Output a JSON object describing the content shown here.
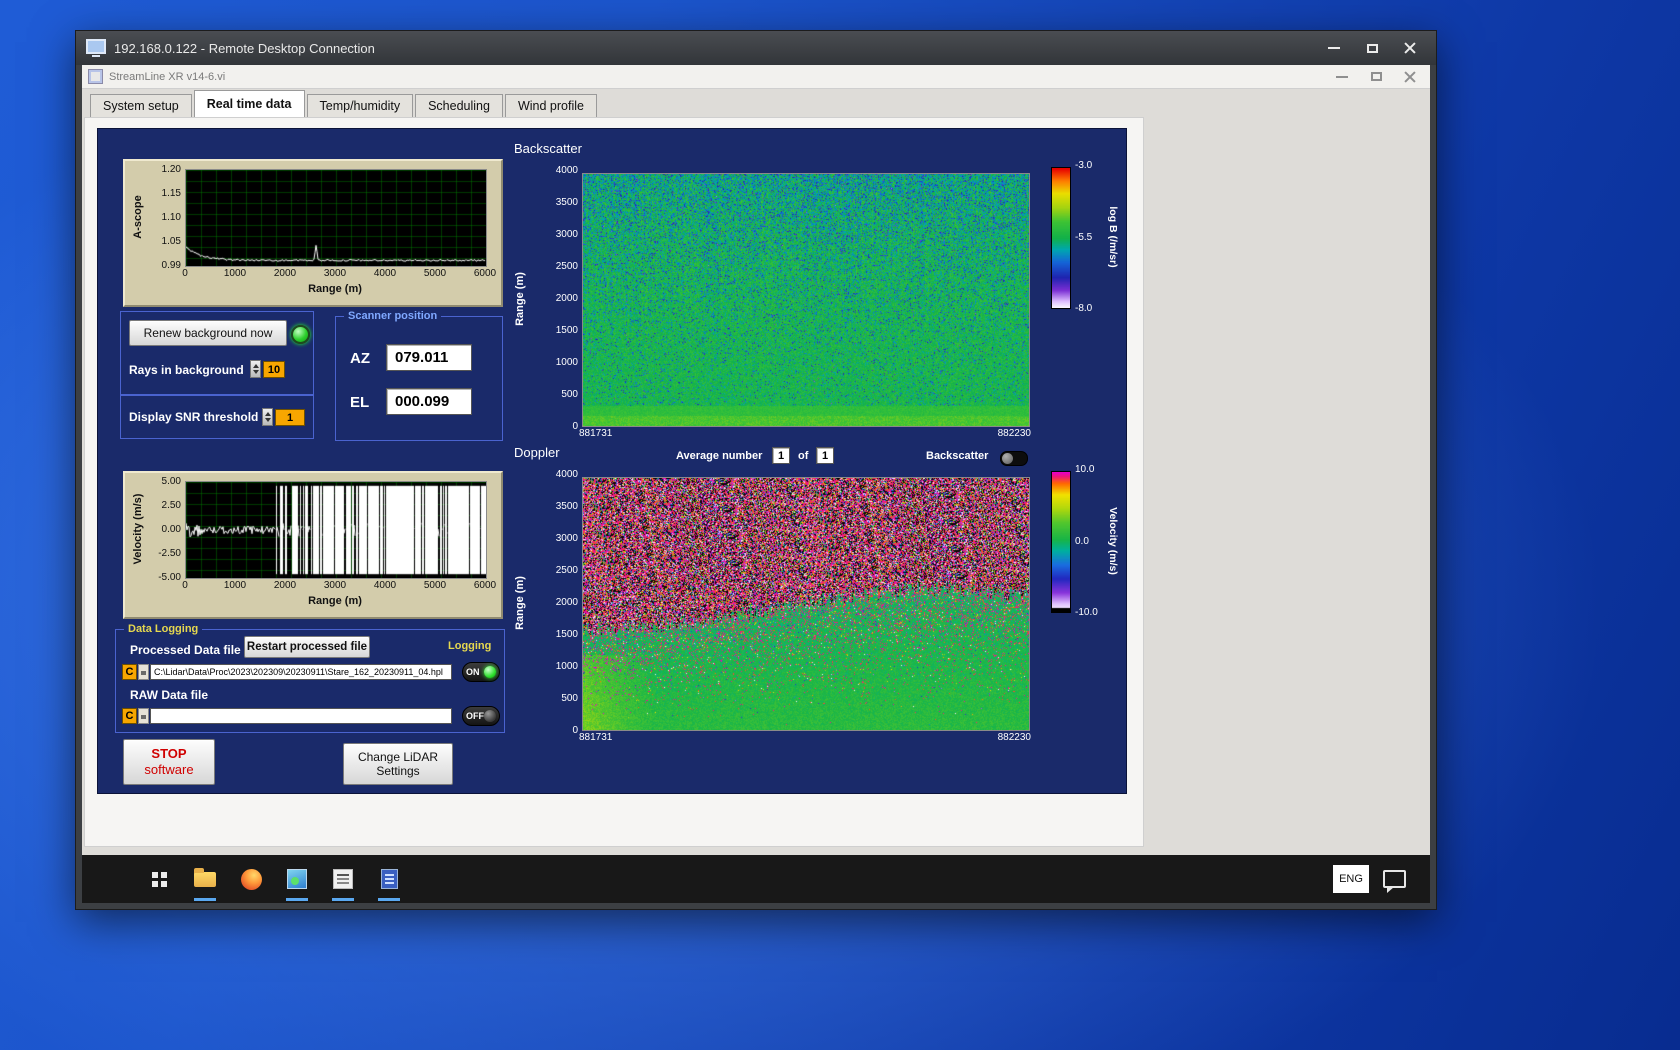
{
  "rdp": {
    "title": "192.168.0.122 - Remote Desktop Connection"
  },
  "app": {
    "title": "StreamLine XR v14-6.vi",
    "tabs": [
      {
        "label": "System setup",
        "active": false
      },
      {
        "label": "Real time data",
        "active": true
      },
      {
        "label": "Temp/humidity",
        "active": false
      },
      {
        "label": "Scheduling",
        "active": false
      },
      {
        "label": "Wind profile",
        "active": false
      }
    ]
  },
  "controls": {
    "renew_button": "Renew background now",
    "rays_label": "Rays in background",
    "rays_value": "10",
    "snr_label": "Display SNR threshold",
    "snr_value": "1",
    "scanner": {
      "title": "Scanner position",
      "az_label": "AZ",
      "az_value": "079.011",
      "el_label": "EL",
      "el_value": "000.099"
    }
  },
  "logging": {
    "title": "Data Logging",
    "processed_label": "Processed Data file",
    "restart_button": "Restart processed file",
    "logging_label": "Logging",
    "drive_letter": "C",
    "processed_path": "C:\\Lidar\\Data\\Proc\\2023\\202309\\20230911\\Stare_162_20230911_04.hpl",
    "raw_label": "RAW Data file",
    "raw_path": "",
    "on_label": "ON",
    "off_label": "OFF"
  },
  "footer_buttons": {
    "stop_line1": "STOP",
    "stop_line2": "software",
    "change_line1": "Change LiDAR",
    "change_line2": "Settings"
  },
  "doppler_controls": {
    "average_label": "Average number",
    "average_value": "1",
    "of_label": "of",
    "of_value": "1",
    "toggle_label": "Backscatter"
  },
  "taskbar": {
    "language": "ENG",
    "items": [
      {
        "name": "start"
      },
      {
        "name": "file-explorer",
        "running": true
      },
      {
        "name": "firefox",
        "running": false
      },
      {
        "name": "photos",
        "running": true
      },
      {
        "name": "scan-scheduler",
        "running": true
      },
      {
        "name": "document-viewer",
        "running": true
      }
    ]
  },
  "chart_data": [
    {
      "id": "ascope",
      "type": "line",
      "ylabel": "A-scope",
      "xlabel": "Range (m)",
      "yticks": [
        "1.20",
        "1.15",
        "1.10",
        "1.05",
        "0.99"
      ],
      "xticks": [
        "0",
        "1000",
        "2000",
        "3000",
        "4000",
        "5000",
        "6000"
      ],
      "ylim": [
        0.985,
        1.205
      ],
      "xlim": [
        0,
        6000
      ],
      "bg": "#000000",
      "grid": "#008200",
      "trace": "#ffffff",
      "description": "White trace near 1.00; slightly elevated (~1.03) below 500 m, small spike near 2600 m"
    },
    {
      "id": "velocity",
      "type": "line",
      "ylabel": "Velocity (m/s)",
      "xlabel": "Range (m)",
      "yticks": [
        "5.00",
        "2.50",
        "0.00",
        "-2.50",
        "-5.00"
      ],
      "xticks": [
        "0",
        "1000",
        "2000",
        "3000",
        "4000",
        "5000",
        "6000"
      ],
      "ylim": [
        -5.5,
        5.5
      ],
      "xlim": [
        0,
        6000
      ],
      "spike_start_m": 1800,
      "bg": "#000000",
      "grid": "#008200",
      "trace": "#ffffff",
      "description": "Low-amplitude noise around 0 below ~1800 m, dense saturated +/-5 m/s vertical spikes beyond"
    },
    {
      "id": "backscatter",
      "type": "heatmap",
      "title": "Backscatter",
      "ylabel": "Range (m)",
      "yticks": [
        "4000",
        "3500",
        "3000",
        "2500",
        "2000",
        "1500",
        "1000",
        "500",
        "0"
      ],
      "xticks": [
        "881731",
        "882230"
      ],
      "ylim": [
        0,
        4000
      ],
      "xlim": [
        881731,
        882230
      ],
      "colorbar": {
        "label": "log B (/m/sr)",
        "ticks": [
          "-3.0",
          "-5.5",
          "-8.0"
        ],
        "range": [
          -3.0,
          -8.0
        ]
      },
      "cmap": [
        [
          0,
          "#ffffff"
        ],
        [
          0.05,
          "#dfc0ff"
        ],
        [
          0.13,
          "#7b2fd4"
        ],
        [
          0.22,
          "#1f24b0"
        ],
        [
          0.33,
          "#1565d8"
        ],
        [
          0.42,
          "#00a8b0"
        ],
        [
          0.5,
          "#12b14a"
        ],
        [
          0.62,
          "#3ec435"
        ],
        [
          0.72,
          "#a6d411"
        ],
        [
          0.82,
          "#eadf00"
        ],
        [
          0.91,
          "#ff7d00"
        ],
        [
          1,
          "#e80000"
        ]
      ],
      "description": "Mostly green (~-5.5) field, blue/dark speckle density increasing with altitude, bright smooth green band below ~500 m"
    },
    {
      "id": "doppler",
      "type": "heatmap",
      "title": "Doppler",
      "ylabel": "Range (m)",
      "yticks": [
        "4000",
        "3500",
        "3000",
        "2500",
        "2000",
        "1500",
        "1000",
        "500",
        "0"
      ],
      "xticks": [
        "881731",
        "882230"
      ],
      "ylim": [
        0,
        4000
      ],
      "xlim": [
        881731,
        882230
      ],
      "colorbar": {
        "label": "Velocity (m/s)",
        "ticks": [
          "10.0",
          "0.0",
          "-10.0"
        ],
        "range": [
          10.0,
          -10.0
        ]
      },
      "cmap": [
        [
          0,
          "#ffffff"
        ],
        [
          0.06,
          "#e2c4ff"
        ],
        [
          0.14,
          "#8a34dc"
        ],
        [
          0.24,
          "#2228c0"
        ],
        [
          0.34,
          "#1a6ee0"
        ],
        [
          0.44,
          "#00b0a0"
        ],
        [
          0.52,
          "#18b547"
        ],
        [
          0.64,
          "#52c72e"
        ],
        [
          0.74,
          "#b0d80e"
        ],
        [
          0.84,
          "#f2e200"
        ],
        [
          0.92,
          "#ff6a00"
        ],
        [
          0.97,
          "#f01878"
        ],
        [
          1,
          "#e800c8"
        ]
      ],
      "description": "Magenta/black random noise above ~2000 m (no signal), smooth green ~0 m/s velocities below, bright green-yellow wedge bottom-left"
    }
  ]
}
